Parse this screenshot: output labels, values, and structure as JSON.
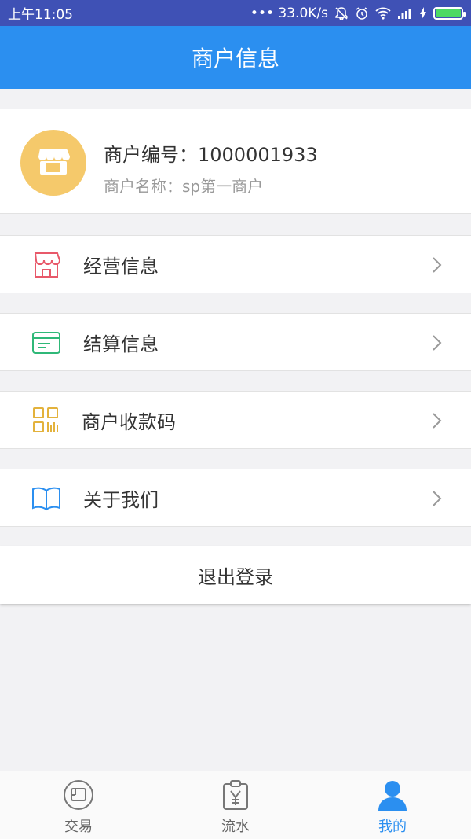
{
  "status_bar": {
    "time": "上午11:05",
    "network_speed": "••• 33.0K/s"
  },
  "header": {
    "title": "商户信息"
  },
  "merchant": {
    "id_text": "商户编号：1000001933",
    "name_text": "商户名称：sp第一商户",
    "avatar_icon": "store-icon",
    "avatar_color": "#f5c96b"
  },
  "menu": {
    "items": [
      {
        "label": "经营信息",
        "icon": "shop-icon",
        "color": "#e8596a"
      },
      {
        "label": "结算信息",
        "icon": "card-icon",
        "color": "#2fb878"
      },
      {
        "label": "商户收款码",
        "icon": "qrcode-icon",
        "color": "#e3b23c"
      },
      {
        "label": "关于我们",
        "icon": "book-icon",
        "color": "#2b8ff0"
      }
    ],
    "logout_label": "退出登录"
  },
  "tabs": {
    "items": [
      {
        "label": "交易",
        "icon": "trade-icon",
        "active": false
      },
      {
        "label": "流水",
        "icon": "ledger-icon",
        "active": false
      },
      {
        "label": "我的",
        "icon": "user-icon",
        "active": true
      }
    ],
    "active_color": "#2b8ff0",
    "inactive_color": "#666666"
  },
  "colors": {
    "header_bg": "#2b8ff0",
    "status_bg": "#3f51b5",
    "page_bg": "#f2f2f4"
  }
}
